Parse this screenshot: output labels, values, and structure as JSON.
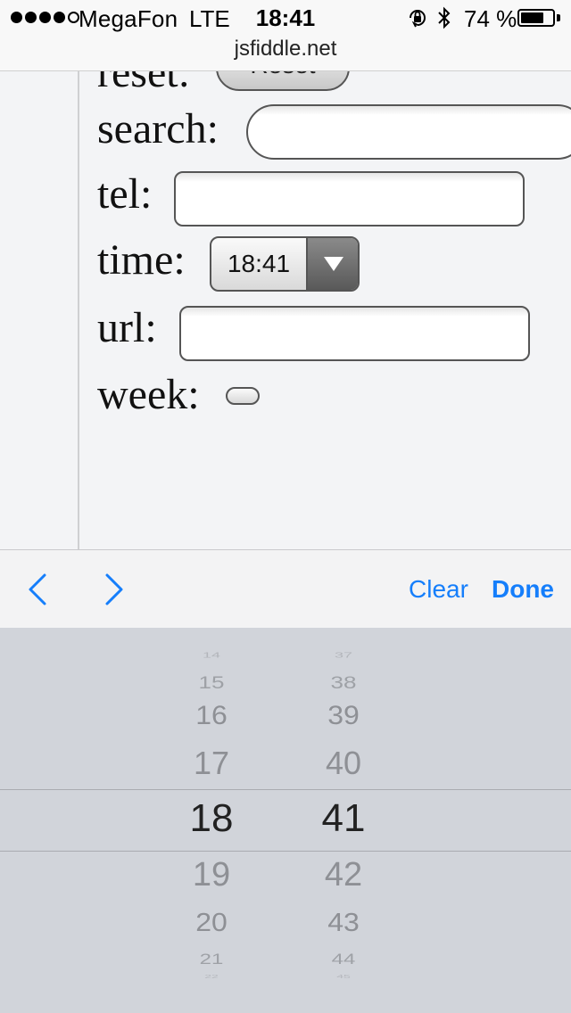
{
  "status_bar": {
    "signal_filled": 4,
    "signal_total": 5,
    "carrier": "MegaFon",
    "network": "LTE",
    "time": "18:41",
    "battery_percent": "74 %",
    "battery_level": 0.74,
    "icons": [
      "orientation-lock-icon",
      "bluetooth-icon",
      "battery-icon"
    ]
  },
  "browser": {
    "address": "jsfiddle.net"
  },
  "form": {
    "reset_label": "reset:",
    "reset_button": "Reset",
    "search_label": "search:",
    "tel_label": "tel:",
    "time_label": "time:",
    "time_value": "18:41",
    "url_label": "url:",
    "week_label": "week:"
  },
  "accessory": {
    "prev_icon": "chevron-left-icon",
    "next_icon": "chevron-right-icon",
    "clear_label": "Clear",
    "done_label": "Done",
    "accent_color": "#157efb"
  },
  "picker": {
    "hours": [
      "14",
      "15",
      "16",
      "17",
      "18",
      "19",
      "20",
      "21",
      "22"
    ],
    "minutes": [
      "37",
      "38",
      "39",
      "40",
      "41",
      "42",
      "43",
      "44",
      "45"
    ],
    "selected_hour": "18",
    "selected_minute": "41"
  }
}
